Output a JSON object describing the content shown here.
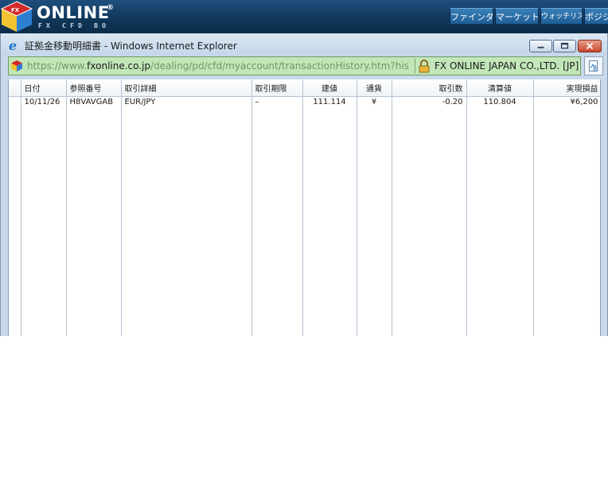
{
  "app": {
    "logo_text": "ONLINE",
    "logo_sub": "FX CFD BO",
    "nav_buttons": [
      "ファインダ",
      "マーケット",
      "ウォッチリスト",
      "ポジション"
    ]
  },
  "window": {
    "title": "証拠金移動明細書 - Windows Internet Explorer",
    "address_url_prefix": "https://www.",
    "address_url_domain": "fxonline.co.jp",
    "address_url_path": "/dealing/pd/cfd/myaccount/transactionHistory.htm?his",
    "certificate": "FX ONLINE JAPAN CO.,LTD. [JP]"
  },
  "table": {
    "headers": [
      "日付",
      "参照番号",
      "取引詳細",
      "取引期限",
      "建値",
      "通貨",
      "取引数",
      "清算値",
      "実現損益"
    ],
    "rows": [
      [
        "10/11/26",
        "H8VAVGAB",
        "EUR/JPY",
        "–",
        "111.114",
        "¥",
        "-0.20",
        "110.804",
        "¥6,200"
      ]
    ]
  },
  "colors": {
    "topbar": "#0f3658",
    "nav_button": "#2a6ea8",
    "address_bar_secure": "#c2e6b8",
    "close_button": "#c7452d",
    "grid_line": "#b5c3d3"
  },
  "icons": {
    "logo": "cube-logo-icon",
    "browser": "internet-explorer-icon",
    "address": "page-cube-icon",
    "lock": "padlock-icon",
    "compat": "compatibility-view-icon"
  }
}
